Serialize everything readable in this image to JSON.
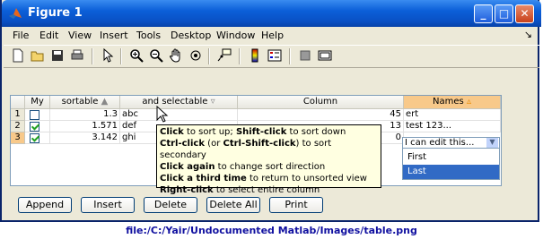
{
  "window": {
    "title": "Figure 1"
  },
  "menu": [
    "File",
    "Edit",
    "View",
    "Insert",
    "Tools",
    "Desktop",
    "Window",
    "Help"
  ],
  "toolbar": {
    "icons": [
      "new-file-icon",
      "open-folder-icon",
      "save-icon",
      "print-icon",
      "pointer-icon",
      "zoom-in-icon",
      "zoom-out-icon",
      "pan-hand-icon",
      "rotate-3d-icon",
      "data-cursor-icon",
      "colorbar-icon",
      "legend-icon",
      "hide-plot-tools-icon",
      "show-plot-tools-icon"
    ]
  },
  "table": {
    "columns": [
      "My",
      "sortable",
      "and selectable",
      "Column",
      "Names"
    ],
    "rows": [
      {
        "num": "1",
        "my": false,
        "sortable": "1.3",
        "selectable": "abc",
        "column": "45",
        "names": "ert"
      },
      {
        "num": "2",
        "my": true,
        "sortable": "1.571",
        "selectable": "def",
        "column": "13",
        "names": "test 123..."
      },
      {
        "num": "3",
        "my": true,
        "sortable": "3.142",
        "selectable": "ghi",
        "column": "0",
        "names": "I can edit this..."
      }
    ]
  },
  "dropdown": {
    "options": [
      "First",
      "Last"
    ],
    "selected": "Last"
  },
  "tooltip": {
    "lines": [
      {
        "b": "Click",
        "t": " to sort up; ",
        "b2": "Shift-click",
        "t2": " to sort down"
      },
      {
        "b": "Ctrl-click",
        "t": " (or ",
        "b2": "Ctrl-Shift-click",
        "t2": ") to sort secondary"
      },
      {
        "b": "Click again",
        "t": " to change sort direction",
        "b2": "",
        "t2": ""
      },
      {
        "b": "Click a third time",
        "t": " to return to unsorted view",
        "b2": "",
        "t2": ""
      },
      {
        "b": "Right-click",
        "t": " to select entire column",
        "b2": "",
        "t2": ""
      }
    ]
  },
  "buttons": [
    "Append",
    "Insert",
    "Delete",
    "Delete All",
    "Print"
  ],
  "footer": "file:/C:/Yair/Undocumented Matlab/Images/table.png",
  "colors": {
    "title_bar": "#0b5fd8",
    "selected_header": "#f8c98a",
    "selection": "#316ac5",
    "tooltip": "#ffffe1"
  }
}
